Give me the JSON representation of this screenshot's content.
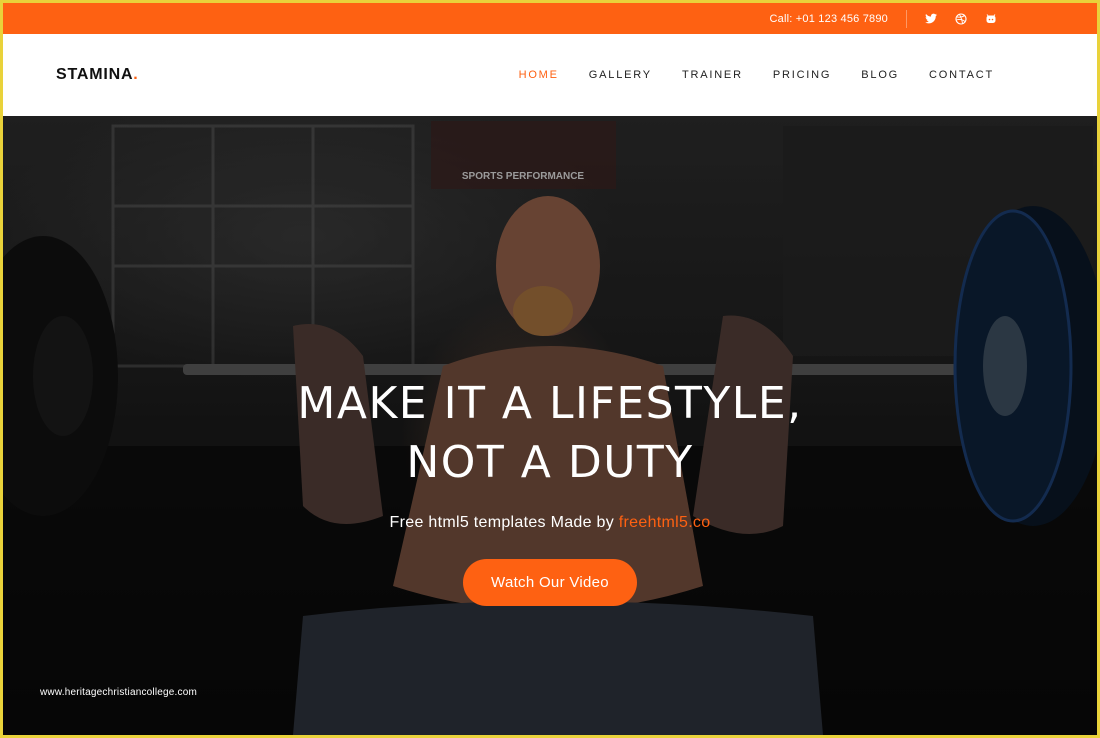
{
  "topbar": {
    "phone": "Call: +01 123 456 7890",
    "social": [
      {
        "icon": "twitter-icon",
        "glyph": "🐦"
      },
      {
        "icon": "dribbble-icon",
        "glyph": "◍"
      },
      {
        "icon": "github-icon",
        "glyph": "▣"
      }
    ]
  },
  "nav": {
    "logo": "STAMINA",
    "logo_dot": ".",
    "items": [
      {
        "label": "HOME",
        "active": true
      },
      {
        "label": "GALLERY",
        "active": false
      },
      {
        "label": "TRAINER",
        "active": false
      },
      {
        "label": "PRICING",
        "active": false
      },
      {
        "label": "BLOG",
        "active": false
      },
      {
        "label": "CONTACT",
        "active": false
      }
    ]
  },
  "hero": {
    "headline_line1": "MAKE IT A LIFESTYLE,",
    "headline_line2": "NOT A DUTY",
    "sub_text": "Free html5 templates Made by ",
    "sub_link": "freehtml5.co",
    "cta_label": "Watch Our Video",
    "banner_text": "SPORTS PERFORMANCE"
  },
  "watermark": "www.heritagechristiancollege.com",
  "colors": {
    "accent": "#fe6112",
    "frame": "#e9d23a"
  }
}
